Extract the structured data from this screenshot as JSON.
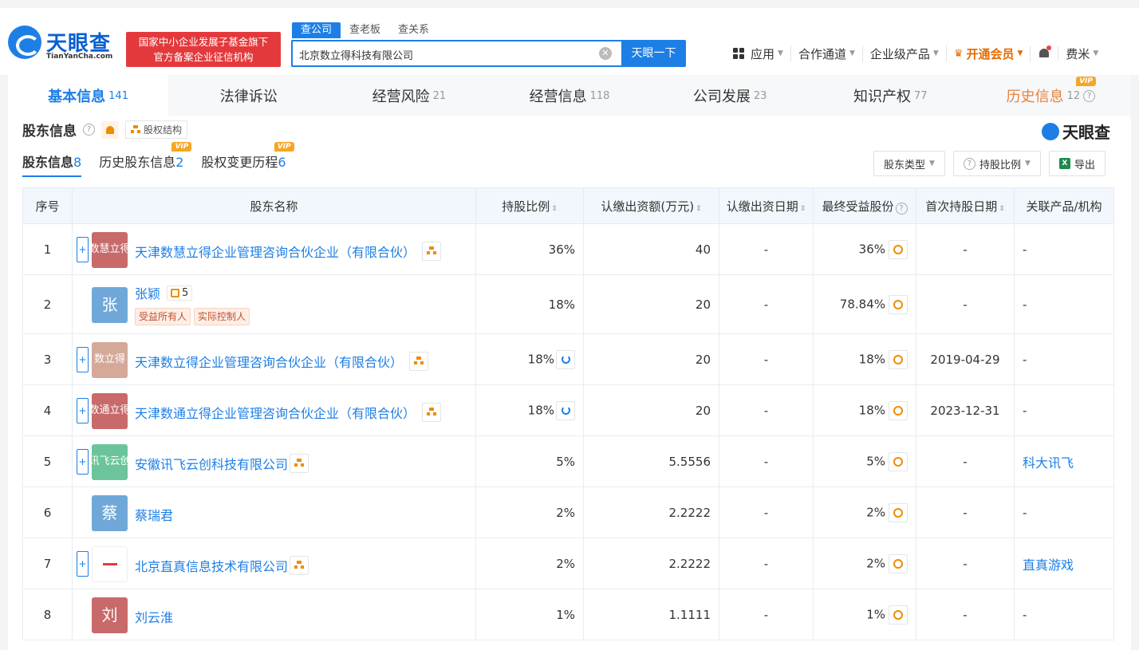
{
  "header": {
    "logo_text": "天眼查",
    "logo_sub": "TianYanCha.com",
    "slogan_line1": "国家中小企业发展子基金旗下",
    "slogan_line2": "官方备案企业征信机构",
    "search_tabs": [
      "查公司",
      "查老板",
      "查关系"
    ],
    "search_value": "北京数立得科技有限公司",
    "search_button": "天眼一下",
    "nav": {
      "apps": "应用",
      "cooperation": "合作通道",
      "enterprise": "企业级产品",
      "vip": "开通会员",
      "user": "费米"
    }
  },
  "main_tabs": [
    {
      "label": "基本信息",
      "count": "141"
    },
    {
      "label": "法律诉讼",
      "count": ""
    },
    {
      "label": "经营风险",
      "count": "21"
    },
    {
      "label": "经营信息",
      "count": "118"
    },
    {
      "label": "公司发展",
      "count": "23"
    },
    {
      "label": "知识产权",
      "count": "77"
    },
    {
      "label": "历史信息",
      "count": "12"
    }
  ],
  "vip_label": "VIP",
  "section": {
    "title": "股东信息",
    "equity_button": "股权结构",
    "brand": "天眼查"
  },
  "sub_tabs": [
    {
      "label": "股东信息",
      "count": "8"
    },
    {
      "label": "历史股东信息",
      "count": "2"
    },
    {
      "label": "股权变更历程",
      "count": "6"
    }
  ],
  "tools": {
    "type_filter": "股东类型",
    "ratio_filter": "持股比例",
    "export": "导出"
  },
  "table": {
    "headers": [
      "序号",
      "股东名称",
      "持股比例",
      "认缴出资额(万元)",
      "认缴出资日期",
      "最终受益股份",
      "首次持股日期",
      "关联产品/机构"
    ],
    "rows": [
      {
        "idx": "1",
        "avatar": "数慧立得",
        "name": "天津数慧立得企业管理咨询合伙企业（有限合伙）",
        "ratio": "36%",
        "amount": "40",
        "date": "-",
        "final": "36%",
        "first": "-",
        "related": "-"
      },
      {
        "idx": "2",
        "avatar": "张",
        "name": "张颖",
        "link_count": "5",
        "badges": [
          "受益所有人",
          "实际控制人"
        ],
        "ratio": "18%",
        "amount": "20",
        "date": "-",
        "final": "78.84%",
        "first": "-",
        "related": "-"
      },
      {
        "idx": "3",
        "avatar": "数立得",
        "name": "天津数立得企业管理咨询合伙企业（有限合伙）",
        "ratio": "18%",
        "amount": "20",
        "date": "-",
        "final": "18%",
        "first": "2019-04-29",
        "related": "-"
      },
      {
        "idx": "4",
        "avatar": "数通立得",
        "name": "天津数通立得企业管理咨询合伙企业（有限合伙）",
        "ratio": "18%",
        "amount": "20",
        "date": "-",
        "final": "18%",
        "first": "2023-12-31",
        "related": "-"
      },
      {
        "idx": "5",
        "avatar": "讯飞云创",
        "name": "安徽讯飞云创科技有限公司",
        "ratio": "5%",
        "amount": "5.5556",
        "date": "-",
        "final": "5%",
        "first": "-",
        "related": "科大讯飞"
      },
      {
        "idx": "6",
        "avatar": "蔡",
        "name": "蔡瑞君",
        "ratio": "2%",
        "amount": "2.2222",
        "date": "-",
        "final": "2%",
        "first": "-",
        "related": "-"
      },
      {
        "idx": "7",
        "avatar": "",
        "name": "北京直真信息技术有限公司",
        "ratio": "2%",
        "amount": "2.2222",
        "date": "-",
        "final": "2%",
        "first": "-",
        "related": "直真游戏"
      },
      {
        "idx": "8",
        "avatar": "刘",
        "name": "刘云淮",
        "ratio": "1%",
        "amount": "1.1111",
        "date": "-",
        "final": "1%",
        "first": "-",
        "related": "-"
      }
    ]
  },
  "colors": {
    "brand_blue": "#1d7fe6",
    "accent_orange": "#f08c00",
    "avatar_red": "#c86a6a",
    "avatar_blue": "#6fa8d8",
    "avatar_tan": "#d4a99a",
    "avatar_green": "#6cc59a"
  }
}
